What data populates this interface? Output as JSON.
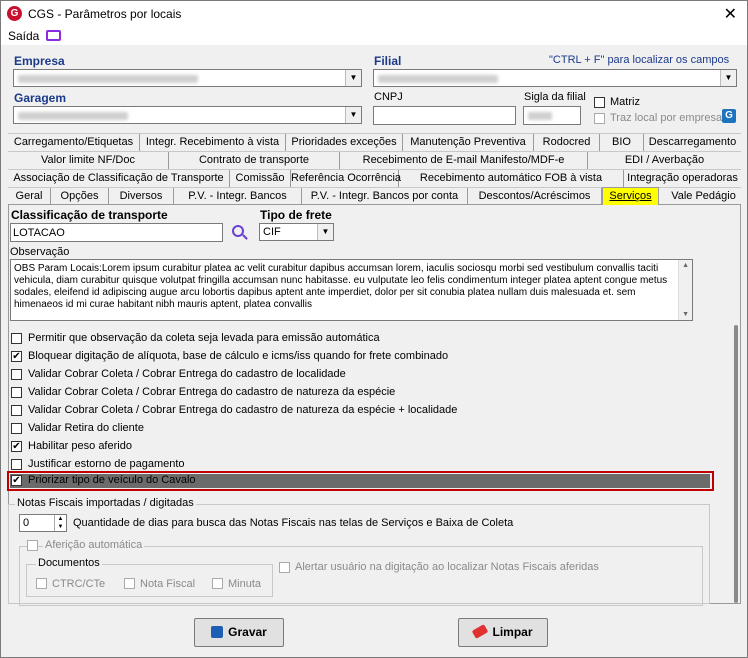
{
  "window": {
    "title": "CGS - Parâmetros por locais",
    "close_label": "✕"
  },
  "menu": {
    "saida": "Saída"
  },
  "empresa": {
    "label": "Empresa"
  },
  "filial": {
    "label": "Filial",
    "hint": "\"CTRL + F\" para localizar os campos"
  },
  "garagem": {
    "label": "Garagem"
  },
  "cnpj": {
    "label": "CNPJ"
  },
  "sigla": {
    "label": "Sigla da filial"
  },
  "matriz": {
    "label": "Matriz",
    "checked": false
  },
  "traz_local": {
    "label": "Traz local por empresa",
    "checked": false
  },
  "tabs": {
    "row1": [
      "Carregamento/Etiquetas",
      "Integr. Recebimento à vista",
      "Prioridades exceções",
      "Manutenção Preventiva",
      "Rodocred",
      "BIO",
      "Descarregamento"
    ],
    "row2": [
      "Valor limite NF/Doc",
      "Contrato de transporte",
      "Recebimento de E-mail Manifesto/MDF-e",
      "EDI / Averbação"
    ],
    "row3": [
      "Associação de Classificação de Transporte",
      "Comissão",
      "Referência Ocorrência",
      "Recebimento automático FOB à vista",
      "Integração operadoras"
    ],
    "row4": [
      "Geral",
      "Opções",
      "Diversos",
      "P.V. - Integr. Bancos",
      "P.V. - Integr. Bancos por conta",
      "Descontos/Acréscimos",
      "Serviços",
      "Vale Pedágio"
    ],
    "selected": "Serviços"
  },
  "classificacao": {
    "label": "Classificação de transporte",
    "value": "LOTACAO"
  },
  "tipo_frete": {
    "label": "Tipo de frete",
    "value": "CIF"
  },
  "observacao": {
    "label": "Observação",
    "value": "OBS Param Locais:Lorem ipsum curabitur platea ac velit curabitur dapibus accumsan lorem, iaculis sociosqu morbi sed vestibulum convallis taciti vehicula, diam curabitur quisque volutpat fringilla accumsan nunc habitasse. eu vulputate leo felis condimentum integer platea aptent congue metus sodales, eleifend id adipiscing augue arcu lobortis dapibus aptent ante imperdiet, dolor per sit conubia platea nullam duis malesuada et. sem himenaeos id mi curae habitant nibh mauris aptent, platea convallis"
  },
  "options": [
    {
      "label": "Permitir que observação da coleta seja levada para emissão automática",
      "checked": false
    },
    {
      "label": "Bloquear digitação de alíquota, base de cálculo e icms/iss quando for frete combinado",
      "checked": true
    },
    {
      "label": "Validar Cobrar Coleta / Cobrar Entrega do cadastro de localidade",
      "checked": false
    },
    {
      "label": "Validar Cobrar Coleta / Cobrar Entrega do cadastro de natureza da espécie",
      "checked": false
    },
    {
      "label": "Validar Cobrar Coleta / Cobrar Entrega do cadastro de natureza da espécie + localidade",
      "checked": false
    },
    {
      "label": "Validar Retira do cliente",
      "checked": false
    },
    {
      "label": "Habilitar peso aferido",
      "checked": true
    },
    {
      "label": "Justificar estorno de pagamento",
      "checked": false
    },
    {
      "label": "Priorizar tipo de veículo do Cavalo",
      "checked": true
    }
  ],
  "notas": {
    "label": "Notas Fiscais importadas / digitadas",
    "dias_value": "0",
    "dias_label": "Quantidade de dias para busca das Notas Fiscais nas telas de Serviços e Baixa de Coleta",
    "afericao_label": "Aferição automática",
    "documentos_label": "Documentos",
    "docs": [
      "CTRC/CTe",
      "Nota Fiscal",
      "Minuta"
    ],
    "alertar_label": "Alertar usuário na digitação ao localizar Notas Fiscais aferidas"
  },
  "buttons": {
    "gravar": "Gravar",
    "limpar": "Limpar"
  }
}
